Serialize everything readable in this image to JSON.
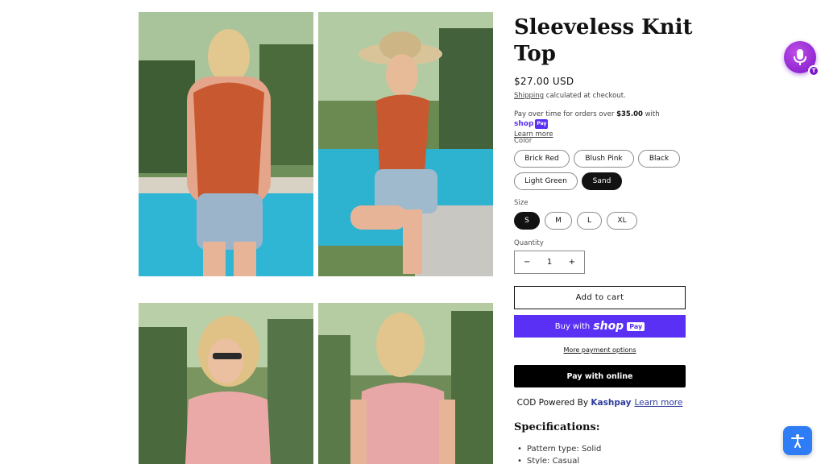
{
  "product": {
    "title": "Sleeveless Knit Top",
    "price": "$27.00 USD",
    "shipping_link": "Shipping",
    "shipping_text": " calculated at checkout.",
    "installments_prefix": "Pay over time for orders over ",
    "installments_amount": "$35.00",
    "installments_with": " with ",
    "shop_label": "shop",
    "pay_label": "Pay",
    "learn_more_small": "Learn more"
  },
  "color": {
    "label": "Color",
    "options": [
      "Brick Red",
      "Blush Pink",
      "Black",
      "Light Green",
      "Sand"
    ],
    "selected": "Sand"
  },
  "size": {
    "label": "Size",
    "options": [
      "S",
      "M",
      "L",
      "XL"
    ],
    "selected": "S"
  },
  "quantity": {
    "label": "Quantity",
    "minus": "−",
    "value": "1",
    "plus": "+"
  },
  "buttons": {
    "add_to_cart": "Add to cart",
    "buy_with": "Buy with",
    "buy_shop": "shop",
    "buy_pay": "Pay",
    "more_payment": "More payment options",
    "pay_online": "Pay with online"
  },
  "cod": {
    "text": "COD Powered By ",
    "brand": "Kashpay",
    "learn_more": "Learn more"
  },
  "specs": {
    "title": "Specifications:",
    "items": [
      "Pattern type: Solid",
      "Style: Casual"
    ]
  },
  "widgets": {
    "mic_badge": "T",
    "mic_icon": "microphone-icon",
    "accessibility_icon": "accessibility-person-icon"
  },
  "gallery": {
    "images": [
      {
        "subject": "woman in brick red knit top, back view by pool"
      },
      {
        "subject": "woman in brick red knit top with straw hat, seated"
      },
      {
        "subject": "woman in blush pink knit top with sunglasses"
      },
      {
        "subject": "woman in blush pink knit top, back view"
      }
    ]
  },
  "colors": {
    "accent_shop": "#5a31f4",
    "kashpay": "#2c3b9c",
    "mic": "#7a16c7",
    "a11y": "#2e7cf6"
  }
}
